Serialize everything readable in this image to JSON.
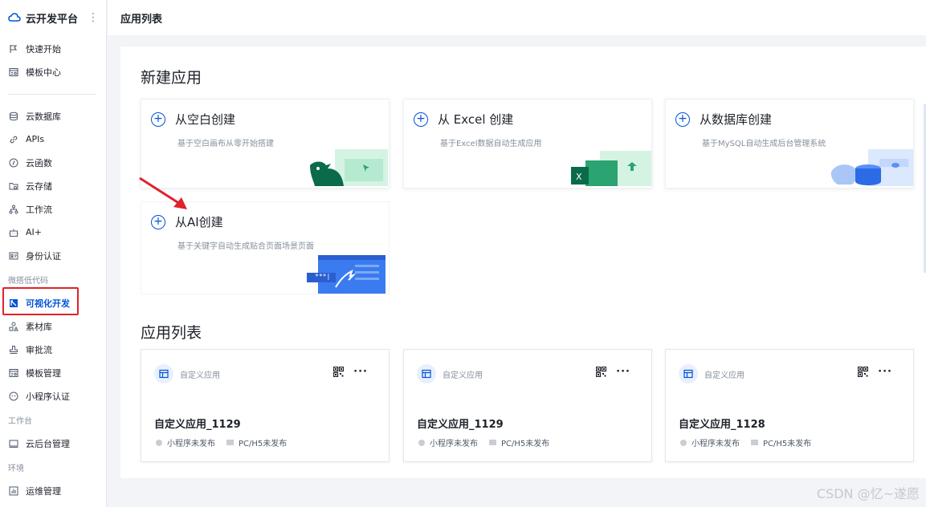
{
  "sidebar": {
    "brand": "云开发平台",
    "items_top": [
      "快速开始",
      "模板中心"
    ],
    "items_main": [
      "云数据库",
      "APIs",
      "云函数",
      "云存储",
      "工作流",
      "AI+",
      "身份认证"
    ],
    "group_lowcode": "微搭低代码",
    "items_lowcode": [
      "可视化开发",
      "素材库",
      "审批流",
      "模板管理",
      "小程序认证"
    ],
    "group_workbench": "工作台",
    "items_workbench": [
      "云后台管理"
    ],
    "group_env": "环境",
    "items_env": [
      "运维管理"
    ]
  },
  "topbar": {
    "title": "应用列表"
  },
  "create_section": {
    "title": "新建应用",
    "cards": [
      {
        "title": "从空白创建",
        "desc": "基于空白画布从零开始搭建"
      },
      {
        "title": "从 Excel 创建",
        "desc": "基于Excel数据自动生成应用"
      },
      {
        "title": "从数据库创建",
        "desc": "基于MySQL自动生成后台管理系统"
      },
      {
        "title": "从AI创建",
        "desc": "基于关键字自动生成贴合页面场景页面"
      }
    ]
  },
  "list_section": {
    "title": "应用列表",
    "apps": [
      {
        "type": "自定义应用",
        "name": "自定义应用_1129",
        "status_mp": "小程序未发布",
        "status_web": "PC/H5未发布"
      },
      {
        "type": "自定义应用",
        "name": "自定义应用_1129",
        "status_mp": "小程序未发布",
        "status_web": "PC/H5未发布"
      },
      {
        "type": "自定义应用",
        "name": "自定义应用_1128",
        "status_mp": "小程序未发布",
        "status_web": "PC/H5未发布"
      }
    ]
  },
  "illustration_text": {
    "ai_input": "***|"
  },
  "watermark": "CSDN @忆~遂愿",
  "colors": {
    "accent": "#0052d9",
    "highlight_box": "#e0222a",
    "arrow": "#e0222a"
  }
}
